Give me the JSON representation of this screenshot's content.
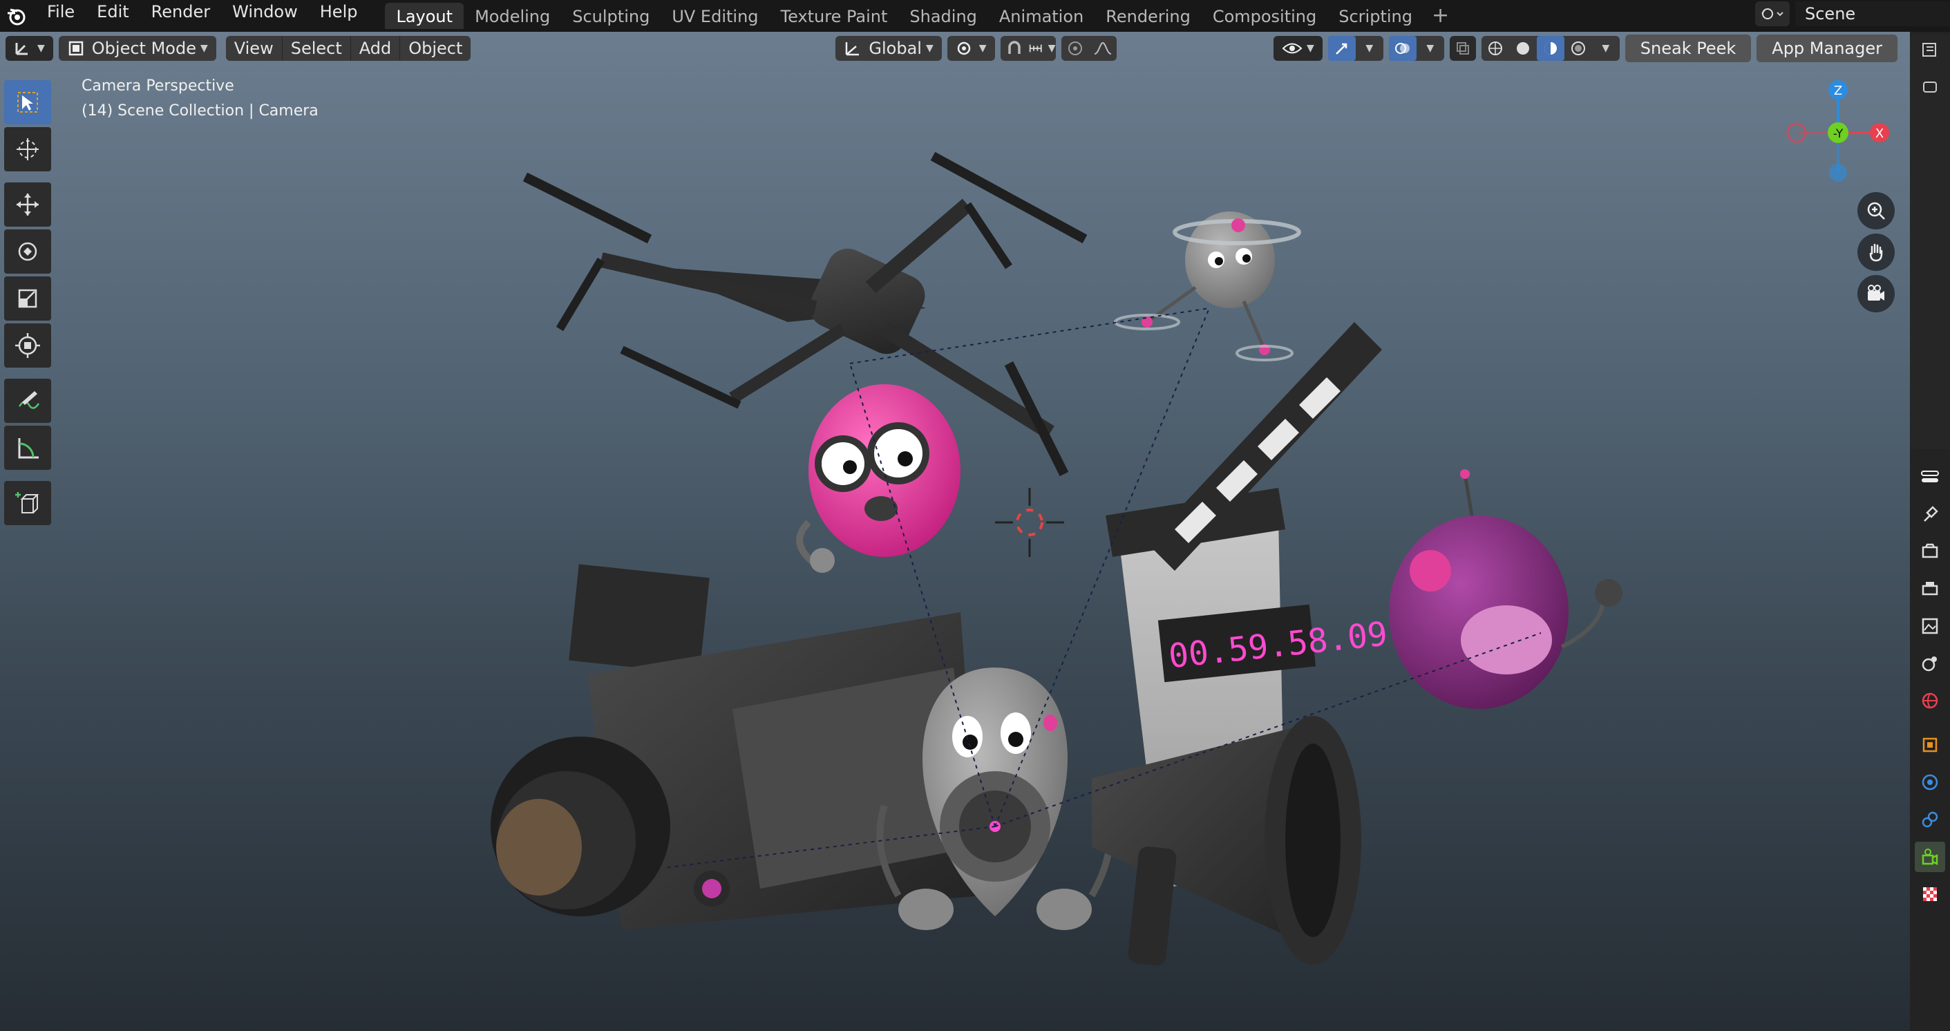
{
  "menubar": {
    "items": [
      "File",
      "Edit",
      "Render",
      "Window",
      "Help"
    ]
  },
  "workspaces": {
    "tabs": [
      "Layout",
      "Modeling",
      "Sculpting",
      "UV Editing",
      "Texture Paint",
      "Shading",
      "Animation",
      "Rendering",
      "Compositing",
      "Scripting"
    ],
    "active": "Layout",
    "add_label": "+"
  },
  "scene": {
    "name": "Scene"
  },
  "viewport_header": {
    "mode": "Object Mode",
    "menus": [
      "View",
      "Select",
      "Add",
      "Object"
    ],
    "orientation": "Global",
    "sneak_peek": "Sneak Peek",
    "app_manager": "App Manager"
  },
  "viewport": {
    "perspective_label": "Camera Perspective",
    "collection_label": "(14) Scene Collection | Camera",
    "timecode": "00.59.58.09"
  },
  "gizmo": {
    "z": "Z",
    "y": "-Y",
    "x": "X"
  },
  "toolbar": {
    "tools": [
      "select-box",
      "cursor",
      "move",
      "rotate",
      "scale",
      "transform",
      "annotate",
      "measure",
      "add-cube"
    ]
  },
  "colors": {
    "accent": "#4772b3",
    "magenta": "#e0409a",
    "timecode": "#ff4ad0",
    "x_axis": "#e8404f",
    "y_axis": "#6ed021",
    "z_axis": "#2c8ce0"
  }
}
